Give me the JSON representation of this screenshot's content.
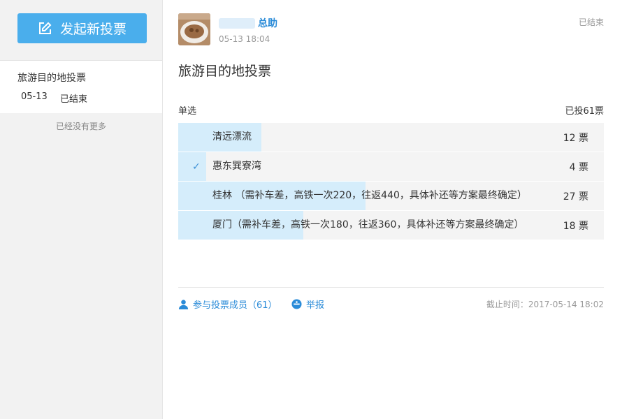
{
  "sidebar": {
    "new_vote_label": "发起新投票",
    "items": [
      {
        "title": "旅游目的地投票",
        "date": "05-13",
        "status": "已结束"
      }
    ],
    "no_more": "已经没有更多"
  },
  "post": {
    "author": "总助",
    "time": "05-13 18:04",
    "status": "已结束",
    "title": "旅游目的地投票",
    "type": "单选",
    "total": "已投61票",
    "options": [
      {
        "label": "清远漂流",
        "count": "12 票",
        "votes": 12,
        "selected": false
      },
      {
        "label": "惠东巽寮湾",
        "count": "4 票",
        "votes": 4,
        "selected": true
      },
      {
        "label": "桂林 （需补车差，高铁一次220，往返440，具体补还等方案最终确定）",
        "count": "27 票",
        "votes": 27,
        "selected": false
      },
      {
        "label": "厦门（需补车差，高铁一次180，往返360，具体补还等方案最终确定）",
        "count": "18 票",
        "votes": 18,
        "selected": false
      }
    ],
    "participants_label": "参与投票成员（61）",
    "report_label": "举报",
    "deadline": "截止时间：2017-05-14 18:02"
  },
  "colors": {
    "accent": "#4aaeec",
    "link": "#2a8bd8",
    "bar_fill": "#d5edfb",
    "bar_bg": "#f4f4f4"
  },
  "icons": {
    "new_vote": "edit-icon",
    "selected": "check-icon",
    "participants": "user-icon",
    "report": "report-icon"
  }
}
